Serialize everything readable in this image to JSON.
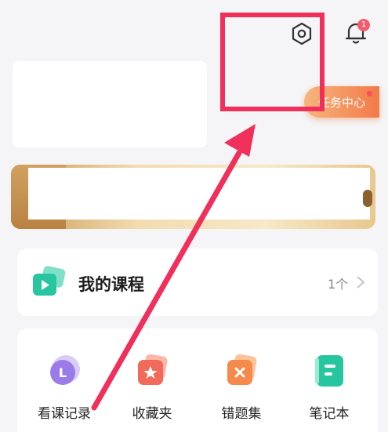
{
  "header": {
    "settings_icon": "gear-hex-icon",
    "bell_icon": "bell-icon",
    "notification_count": "1"
  },
  "task_center": {
    "label": "任务中心"
  },
  "my_courses": {
    "title": "我的课程",
    "count": "1个",
    "icon": "play-card-icon"
  },
  "shortcuts": [
    {
      "label": "看课记录",
      "icon": "history-icon",
      "color": "#9a7be8"
    },
    {
      "label": "收藏夹",
      "icon": "star-icon",
      "color": "#f26a5a"
    },
    {
      "label": "错题集",
      "icon": "wrong-answers-icon",
      "color": "#f58a4a"
    },
    {
      "label": "笔记本",
      "icon": "notebook-icon",
      "color": "#27c6a0"
    }
  ],
  "colors": {
    "accent_red": "#f0305a",
    "task_orange": "#f27a48",
    "teal": "#27c6a0"
  }
}
